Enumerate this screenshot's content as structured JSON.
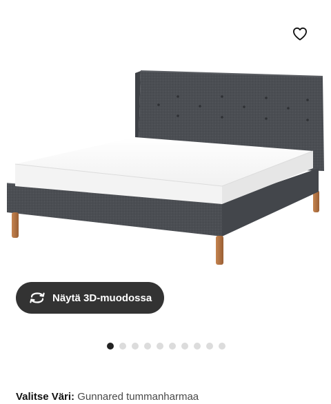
{
  "product": {
    "image_alt": "IDANÄS sängynrunko, Gunnared tummanharmaa",
    "favourite_icon": "heart-outline-icon"
  },
  "viewer": {
    "button_label": "Näytä 3D-muodossa",
    "button_icon": "rotate-3d-icon"
  },
  "carousel": {
    "total_images": 10,
    "active_index": 0
  },
  "variant": {
    "label": "Valitse Väri:",
    "value": "Gunnared tummanharmaa"
  },
  "colors": {
    "button_bg": "#333333",
    "upholstery": "#4a4d52",
    "mattress": "#f6f6f6",
    "legs": "#b07040"
  }
}
